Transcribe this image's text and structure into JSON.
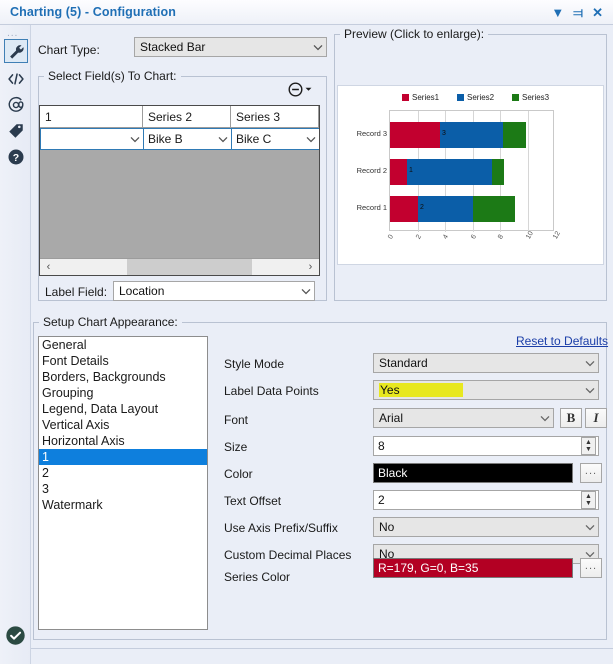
{
  "window": {
    "title": "Charting (5) - Configuration",
    "buttons": [
      {
        "name": "dropdown",
        "glyph": "▼"
      },
      {
        "name": "pin",
        "glyph": "⫤"
      },
      {
        "name": "close",
        "glyph": "✕"
      }
    ]
  },
  "rail": {
    "dots": "∙∙∙",
    "icons": [
      {
        "name": "wrench-icon",
        "selected": true
      },
      {
        "name": "code-icon",
        "selected": false
      },
      {
        "name": "annotation-icon",
        "selected": false
      },
      {
        "name": "tag-icon",
        "selected": false
      },
      {
        "name": "help-icon",
        "selected": false
      }
    ],
    "status_icon": "check-circle-icon"
  },
  "chart_type": {
    "label": "Chart Type:",
    "value": "Stacked Bar"
  },
  "select_fields": {
    "legend": "Select Field(s) To Chart:",
    "remove_button": "remove-field-button",
    "columns": [
      "1",
      "Series 2",
      "Series 3"
    ],
    "values": [
      "",
      "Bike B",
      "Bike C"
    ],
    "scroll_left": "‹",
    "scroll_right": "›"
  },
  "label_field": {
    "label": "Label Field:",
    "value": "Location"
  },
  "preview": {
    "legend": "Preview (Click to enlarge):"
  },
  "appearance": {
    "legend": "Setup Chart Appearance:",
    "reset_link": "Reset to Defaults",
    "items": [
      {
        "label": "General",
        "selected": false
      },
      {
        "label": "Font Details",
        "selected": false
      },
      {
        "label": "Borders, Backgrounds",
        "selected": false
      },
      {
        "label": "Grouping",
        "selected": false
      },
      {
        "label": "Legend, Data Layout",
        "selected": false
      },
      {
        "label": "Vertical Axis",
        "selected": false
      },
      {
        "label": "Horizontal Axis",
        "selected": false
      },
      {
        "label": "1",
        "selected": true
      },
      {
        "label": "2",
        "selected": false
      },
      {
        "label": "3",
        "selected": false
      },
      {
        "label": "Watermark",
        "selected": false
      }
    ]
  },
  "properties": {
    "style_mode": {
      "label": "Style Mode",
      "value": "Standard"
    },
    "label_data_points": {
      "label": "Label Data Points",
      "value": "Yes",
      "highlight": "#e8e81e"
    },
    "font": {
      "label": "Font",
      "value": "Arial",
      "bold_button": "B",
      "italic_button": "I"
    },
    "size": {
      "label": "Size",
      "value": "8"
    },
    "color": {
      "label": "Color",
      "value": "Black",
      "swatch": "#000000",
      "browse": "..."
    },
    "text_offset": {
      "label": "Text Offset",
      "value": "2"
    },
    "use_axis_prefix_suffix": {
      "label": "Use Axis Prefix/Suffix",
      "value": "No"
    },
    "custom_decimal_places": {
      "label": "Custom Decimal Places",
      "value": "No"
    },
    "series_color": {
      "label": "Series Color",
      "value": "R=179, G=0, B=35",
      "swatch": "#b30023",
      "browse": "..."
    }
  },
  "chart_data": {
    "type": "bar",
    "orientation": "horizontal",
    "stacked": true,
    "title": "",
    "xlabel": "",
    "ylabel": "",
    "categories": [
      "Record 1",
      "Record 2",
      "Record 3"
    ],
    "series": [
      {
        "name": "Series1",
        "color": "#c2002f",
        "values": [
          2,
          1.2,
          3.6
        ]
      },
      {
        "name": "Series2",
        "color": "#0b5ea8",
        "values": [
          4,
          6.2,
          4.6
        ]
      },
      {
        "name": "Series3",
        "color": "#1c7a16",
        "values": [
          3.1,
          0.9,
          1.7
        ]
      }
    ],
    "data_labels": [
      "2",
      "1",
      "3"
    ],
    "xticks": [
      "0",
      "2",
      "4",
      "6",
      "8",
      "10",
      "12"
    ],
    "xlim": [
      0,
      12
    ],
    "grid": true,
    "legend": {
      "position": "top",
      "entries": [
        {
          "label": "Series1",
          "color": "#c2002f"
        },
        {
          "label": "Series2",
          "color": "#0b5ea8"
        },
        {
          "label": "Series3",
          "color": "#1c7a16"
        }
      ]
    }
  }
}
